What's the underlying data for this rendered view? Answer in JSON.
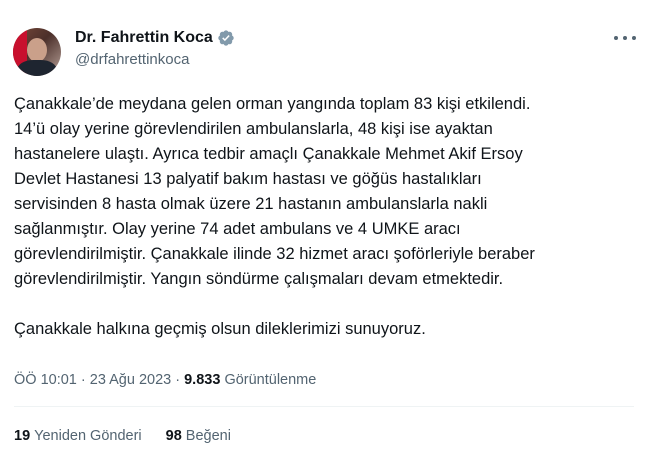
{
  "author": {
    "display_name": "Dr. Fahrettin Koca",
    "handle": "@drfahrettinkoca",
    "verified_icon": "verified-badge-icon"
  },
  "tweet": {
    "lines": [
      "Çanakkale’de meydana gelen orman yangında toplam 83 kişi etkilendi.",
      "14’ü olay yerine görevlendirilen ambulanslarla, 48 kişi ise ayaktan",
      "hastanelere ulaştı. Ayrıca tedbir amaçlı Çanakkale Mehmet Akif Ersoy",
      "Devlet Hastanesi 13 palyatif bakım hastası ve göğüs hastalıkları",
      "servisinden 8 hasta olmak üzere 21 hastanın ambulanslarla nakli",
      "sağlanmıştır. Olay yerine 74 adet ambulans ve 4 UMKE aracı",
      "görevlendirilmiştir. Çanakkale ilinde 32 hizmet aracı şoförleriyle beraber",
      "görevlendirilmiştir. Yangın söndürme çalışmaları devam etmektedir."
    ],
    "closing": "Çanakkale halkına geçmiş olsun dileklerimizi sunuyoruz."
  },
  "meta": {
    "time": "ÖÖ 10:01",
    "separator": " · ",
    "date": "23 Ağu 2023",
    "views_count": "9.833",
    "views_label": "Görüntülenme"
  },
  "stats": {
    "retweets_count": "19",
    "retweets_label": "Yeniden Gönderi",
    "likes_count": "98",
    "likes_label": "Beğeni"
  },
  "colors": {
    "text": "#0f1419",
    "secondary": "#536471",
    "verified": "#829aab",
    "divider": "#eff3f4"
  }
}
